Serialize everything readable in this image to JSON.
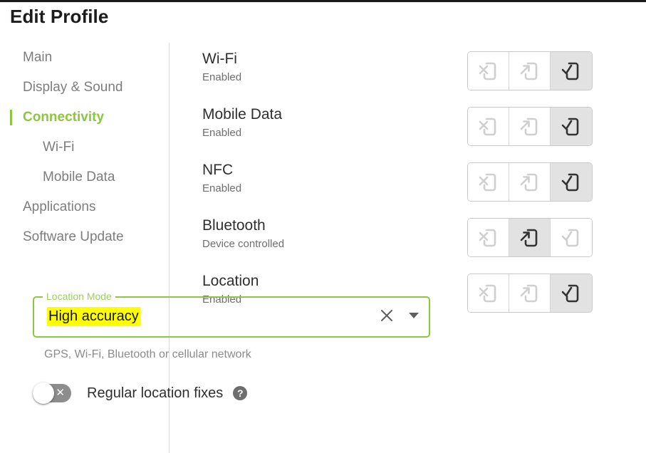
{
  "window": {
    "title": "Edit Profile"
  },
  "sidebar": {
    "items": [
      {
        "label": "Main",
        "level": 0,
        "active": false
      },
      {
        "label": "Display & Sound",
        "level": 0,
        "active": false
      },
      {
        "label": "Connectivity",
        "level": 0,
        "active": true
      },
      {
        "label": "Wi-Fi",
        "level": 1,
        "active": false
      },
      {
        "label": "Mobile Data",
        "level": 1,
        "active": false
      },
      {
        "label": "Applications",
        "level": 0,
        "active": false
      },
      {
        "label": "Software Update",
        "level": 0,
        "active": false
      }
    ]
  },
  "settings": {
    "options": [
      {
        "icon": "phone-x-icon",
        "name": "disabled"
      },
      {
        "icon": "phone-arrow-icon",
        "name": "device-controlled"
      },
      {
        "icon": "phone-check-icon",
        "name": "enabled"
      }
    ],
    "rows": [
      {
        "title": "Wi-Fi",
        "status": "Enabled",
        "selected": 2
      },
      {
        "title": "Mobile Data",
        "status": "Enabled",
        "selected": 2
      },
      {
        "title": "NFC",
        "status": "Enabled",
        "selected": 2
      },
      {
        "title": "Bluetooth",
        "status": "Device controlled",
        "selected": 1
      },
      {
        "title": "Location",
        "status": "Enabled",
        "selected": 2
      }
    ]
  },
  "location_mode": {
    "label": "Location Mode",
    "value": "High accuracy",
    "helper": "GPS, Wi-Fi, Bluetooth or cellular network",
    "clear_icon": "close-icon",
    "dropdown_icon": "chevron-down-icon",
    "highlight_color": "#FFFF00",
    "accent_color": "#8DC63F"
  },
  "regular_fixes": {
    "label": "Regular location fixes",
    "state": "off",
    "off_mark": "✕",
    "help_icon": "help-icon",
    "help_glyph": "?"
  }
}
